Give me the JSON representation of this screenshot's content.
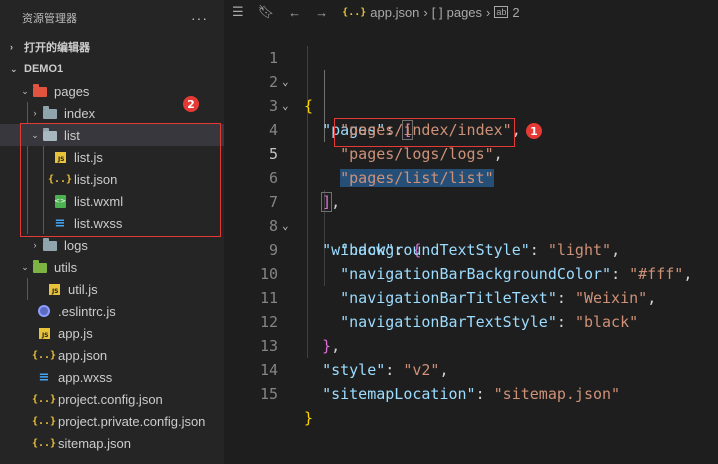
{
  "sidebar": {
    "title": "资源管理器",
    "more": "···",
    "sections": {
      "open_editors": "打开的编辑器",
      "project": "DEMO1"
    },
    "tree": [
      {
        "label": "pages",
        "chev": "⌄",
        "kind": "folder-pages",
        "depth": 1
      },
      {
        "label": "index",
        "chev": "›",
        "kind": "folder",
        "depth": 2
      },
      {
        "label": "list",
        "chev": "⌄",
        "kind": "folder-open",
        "depth": 2
      },
      {
        "label": "list.js",
        "kind": "js",
        "depth": 3
      },
      {
        "label": "list.json",
        "kind": "json",
        "depth": 3
      },
      {
        "label": "list.wxml",
        "kind": "wxml",
        "depth": 3
      },
      {
        "label": "list.wxss",
        "kind": "wxss",
        "depth": 3
      },
      {
        "label": "logs",
        "chev": "›",
        "kind": "folder",
        "depth": 2
      },
      {
        "label": "utils",
        "chev": "⌄",
        "kind": "folder-utils",
        "depth": 1
      },
      {
        "label": "util.js",
        "kind": "js",
        "depth": 2
      },
      {
        "label": ".eslintrc.js",
        "kind": "eslint",
        "depth": 1
      },
      {
        "label": "app.js",
        "kind": "js",
        "depth": 1
      },
      {
        "label": "app.json",
        "kind": "json",
        "depth": 1
      },
      {
        "label": "app.wxss",
        "kind": "wxss",
        "depth": 1
      },
      {
        "label": "project.config.json",
        "kind": "json",
        "depth": 1
      },
      {
        "label": "project.private.config.json",
        "kind": "json",
        "depth": 1
      },
      {
        "label": "sitemap.json",
        "kind": "json",
        "depth": 1
      }
    ],
    "badge": "2"
  },
  "editor": {
    "breadcrumb": {
      "file_icon": "{..}",
      "file": "app.json",
      "array_icon": "[ ]",
      "key": "pages",
      "item_icon": "ab",
      "index": "2"
    },
    "badge": "1",
    "line_numbers": [
      "1",
      "2",
      "3",
      "4",
      "5",
      "6",
      "7",
      "8",
      "9",
      "10",
      "11",
      "12",
      "13",
      "14",
      "15"
    ],
    "active_line": "5",
    "code": {
      "l1_brace": "{",
      "l2_key": "\"pages\"",
      "l2_colon": ": ",
      "l2_bracket": "[",
      "l3": "\"pages/index/index\"",
      "l4": "\"pages/logs/logs\"",
      "l5": "\"pages/list/list\"",
      "comma": ",",
      "l6_bracket": "]",
      "l7_key": "\"window\"",
      "l7_brace": "{",
      "l8_key": "\"backgroundTextStyle\"",
      "l8_val": "\"light\"",
      "l9_key": "\"navigationBarBackgroundColor\"",
      "l9_val": "\"#fff\"",
      "l10_key": "\"navigationBarTitleText\"",
      "l10_val": "\"Weixin\"",
      "l11_key": "\"navigationBarTextStyle\"",
      "l11_val": "\"black\"",
      "l12_brace": "}",
      "l13_key": "\"style\"",
      "l13_val": "\"v2\"",
      "l14_key": "\"sitemapLocation\"",
      "l14_val": "\"sitemap.json\"",
      "l15_brace": "}"
    }
  },
  "colors": {
    "annotation_red": "#e53935",
    "selection": "#264f78",
    "string": "#ce9178",
    "key": "#9cdcfe"
  }
}
